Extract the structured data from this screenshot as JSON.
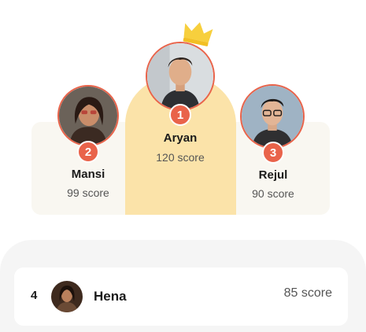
{
  "podium": {
    "first": {
      "rank": "1",
      "name": "Aryan",
      "score": "120 score"
    },
    "second": {
      "rank": "2",
      "name": "Mansi",
      "score": "99 score"
    },
    "third": {
      "rank": "3",
      "name": "Rejul",
      "score": "90 score"
    }
  },
  "leaderboard": [
    {
      "rank": "4",
      "name": "Hena",
      "score": "85 score"
    }
  ],
  "colors": {
    "accent": "#e9634a",
    "podium_highlight": "#fbe3a9",
    "podium_side": "#f9f7f1",
    "crown": "#f7cf3d",
    "list_bg": "#f5f5f5"
  },
  "icons": {
    "crown": "crown-icon"
  }
}
